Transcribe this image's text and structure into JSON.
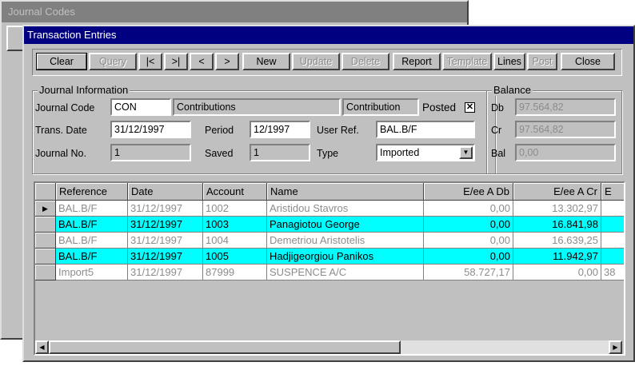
{
  "background_window": {
    "title": "Journal Codes"
  },
  "window": {
    "title": "Transaction Entries"
  },
  "toolbar": [
    {
      "label": "Clear",
      "enabled": true,
      "default": true
    },
    {
      "label": "Query",
      "enabled": false
    },
    {
      "label": "|<",
      "enabled": true
    },
    {
      "label": ">|",
      "enabled": true
    },
    {
      "label": "<",
      "enabled": true
    },
    {
      "label": ">",
      "enabled": true
    },
    {
      "label": "New",
      "enabled": true
    },
    {
      "label": "Update",
      "enabled": false
    },
    {
      "label": "Delete",
      "enabled": false
    },
    {
      "label": "Report",
      "enabled": true
    },
    {
      "label": "Template",
      "enabled": false
    },
    {
      "label": "Lines",
      "enabled": true
    },
    {
      "label": "Post",
      "enabled": false
    },
    {
      "label": "Close",
      "enabled": true
    }
  ],
  "journal": {
    "group_label": "Journal Information",
    "code_label": "Journal  Code",
    "code": "CON",
    "code_desc": "Contributions",
    "code_type": "Contribution",
    "posted_label": "Posted",
    "posted_mark": "✕",
    "date_label": "Trans. Date",
    "date": "31/12/1997",
    "period_label": "Period",
    "period": "12/1997",
    "userref_label": "User Ref.",
    "userref": "BAL.B/F",
    "no_label": "Journal No.",
    "no": "1",
    "saved_label": "Saved",
    "saved": "1",
    "type_label": "Type",
    "type": "Imported"
  },
  "balance": {
    "group_label": "Balance",
    "db_label": "Db",
    "db": "97.564,82",
    "cr_label": "Cr",
    "cr": "97.564,82",
    "bal_label": "Bal",
    "bal": "0,00"
  },
  "grid": {
    "columns": [
      "Reference",
      "Date",
      "Account",
      "Name",
      "E/ee A Db",
      "E/ee A Cr",
      "E"
    ],
    "rows": [
      {
        "current": true,
        "highlight": false,
        "dim": true,
        "cells": [
          "BAL.B/F",
          "31/12/1997",
          "1002",
          "Aristidou Stavros",
          "0,00",
          "13.302,97",
          ""
        ]
      },
      {
        "current": false,
        "highlight": true,
        "dim": false,
        "cells": [
          "BAL.B/F",
          "31/12/1997",
          "1003",
          "Panagiotou George",
          "0,00",
          "16.841,98",
          ""
        ]
      },
      {
        "current": false,
        "highlight": false,
        "dim": true,
        "cells": [
          "BAL.B/F",
          "31/12/1997",
          "1004",
          "Demetriou Aristotelis",
          "0,00",
          "16.639,25",
          ""
        ]
      },
      {
        "current": false,
        "highlight": true,
        "dim": false,
        "cells": [
          "BAL.B/F",
          "31/12/1997",
          "1005",
          "Hadjigeorgiou Panikos",
          "0,00",
          "11.942,97",
          ""
        ]
      },
      {
        "current": false,
        "highlight": false,
        "dim": true,
        "cells": [
          "Import5",
          "31/12/1997",
          "87999",
          "SUSPENCE A/C",
          "58.727,17",
          "0,00",
          "38"
        ]
      }
    ],
    "current_marker": "▶",
    "scroll_left": "◀",
    "scroll_right": "▶"
  },
  "colors": {
    "highlight": "#00ffff",
    "dim_text": "#8c8c8c",
    "title": "#000080",
    "face": "#c0c0c0"
  }
}
